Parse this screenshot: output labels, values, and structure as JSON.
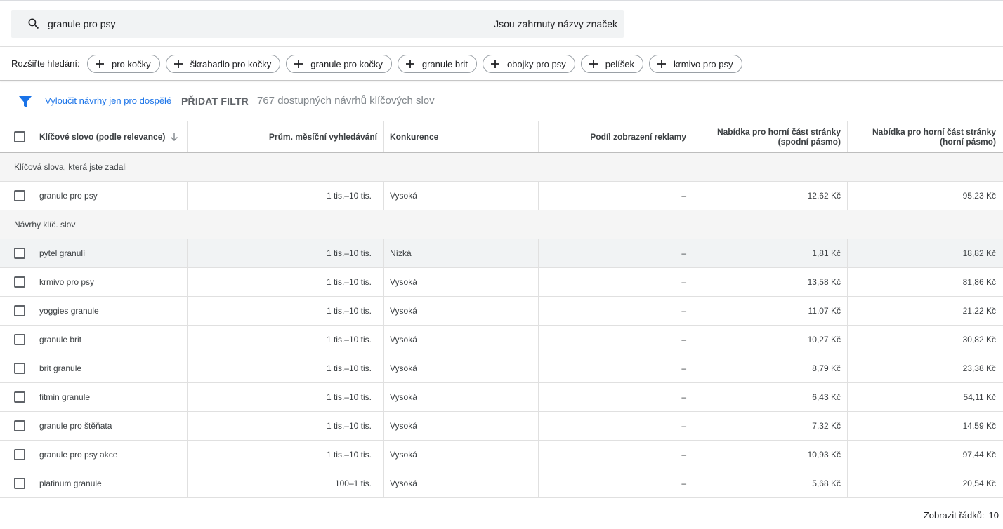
{
  "search": {
    "query": "granule pro psy",
    "brand_note": "Jsou zahrnuty názvy značek"
  },
  "expand": {
    "label": "Rozšiřte hledání:",
    "chips": [
      "pro kočky",
      "škrabadlo pro kočky",
      "granule pro kočky",
      "granule brit",
      "obojky pro psy",
      "pelíšek",
      "krmivo pro psy"
    ]
  },
  "filters": {
    "adult_filter": "Vyloučit návrhy jen pro dospělé",
    "add_filter": "PŘIDAT FILTR",
    "count_text": "767 dostupných návrhů klíčových slov"
  },
  "table": {
    "headers": {
      "keyword": "Klíčové slovo (podle relevance)",
      "avg_searches": "Prům. měsíční vyhledávání",
      "competition": "Konkurence",
      "impression_share": "Podíl zobrazení reklamy",
      "bid_low": "Nabídka pro horní část stránky (spodní pásmo)",
      "bid_high": "Nabídka pro horní část stránky (horní pásmo)"
    },
    "group_entered": "Klíčová slova, která jste zadali",
    "entered_rows": [
      {
        "keyword": "granule pro psy",
        "avg": "1 tis.–10 tis.",
        "comp": "Vysoká",
        "share": "–",
        "low": "12,62 Kč",
        "high": "95,23 Kč"
      }
    ],
    "group_ideas": "Návrhy klíč. slov",
    "idea_rows": [
      {
        "keyword": "pytel granulí",
        "avg": "1 tis.–10 tis.",
        "comp": "Nízká",
        "share": "–",
        "low": "1,81 Kč",
        "high": "18,82 Kč"
      },
      {
        "keyword": "krmivo pro psy",
        "avg": "1 tis.–10 tis.",
        "comp": "Vysoká",
        "share": "–",
        "low": "13,58 Kč",
        "high": "81,86 Kč"
      },
      {
        "keyword": "yoggies granule",
        "avg": "1 tis.–10 tis.",
        "comp": "Vysoká",
        "share": "–",
        "low": "11,07 Kč",
        "high": "21,22 Kč"
      },
      {
        "keyword": "granule brit",
        "avg": "1 tis.–10 tis.",
        "comp": "Vysoká",
        "share": "–",
        "low": "10,27 Kč",
        "high": "30,82 Kč"
      },
      {
        "keyword": "brit granule",
        "avg": "1 tis.–10 tis.",
        "comp": "Vysoká",
        "share": "–",
        "low": "8,79 Kč",
        "high": "23,38 Kč"
      },
      {
        "keyword": "fitmin granule",
        "avg": "1 tis.–10 tis.",
        "comp": "Vysoká",
        "share": "–",
        "low": "6,43 Kč",
        "high": "54,11 Kč"
      },
      {
        "keyword": "granule pro štěňata",
        "avg": "1 tis.–10 tis.",
        "comp": "Vysoká",
        "share": "–",
        "low": "7,32 Kč",
        "high": "14,59 Kč"
      },
      {
        "keyword": "granule pro psy akce",
        "avg": "1 tis.–10 tis.",
        "comp": "Vysoká",
        "share": "–",
        "low": "10,93 Kč",
        "high": "97,44 Kč"
      },
      {
        "keyword": "platinum granule",
        "avg": "100–1 tis.",
        "comp": "Vysoká",
        "share": "–",
        "low": "5,68 Kč",
        "high": "20,54 Kč"
      }
    ]
  },
  "footer": {
    "rows_label": "Zobrazit řádků:",
    "rows_value": "10"
  },
  "colors": {
    "accent": "#1a73e8",
    "search_bg": "#f1f3f4",
    "group_bg": "#f5f5f5"
  },
  "icons": {
    "search": "search-icon",
    "add": "plus-icon",
    "filter": "filter-icon",
    "sort": "arrow-down-icon"
  }
}
